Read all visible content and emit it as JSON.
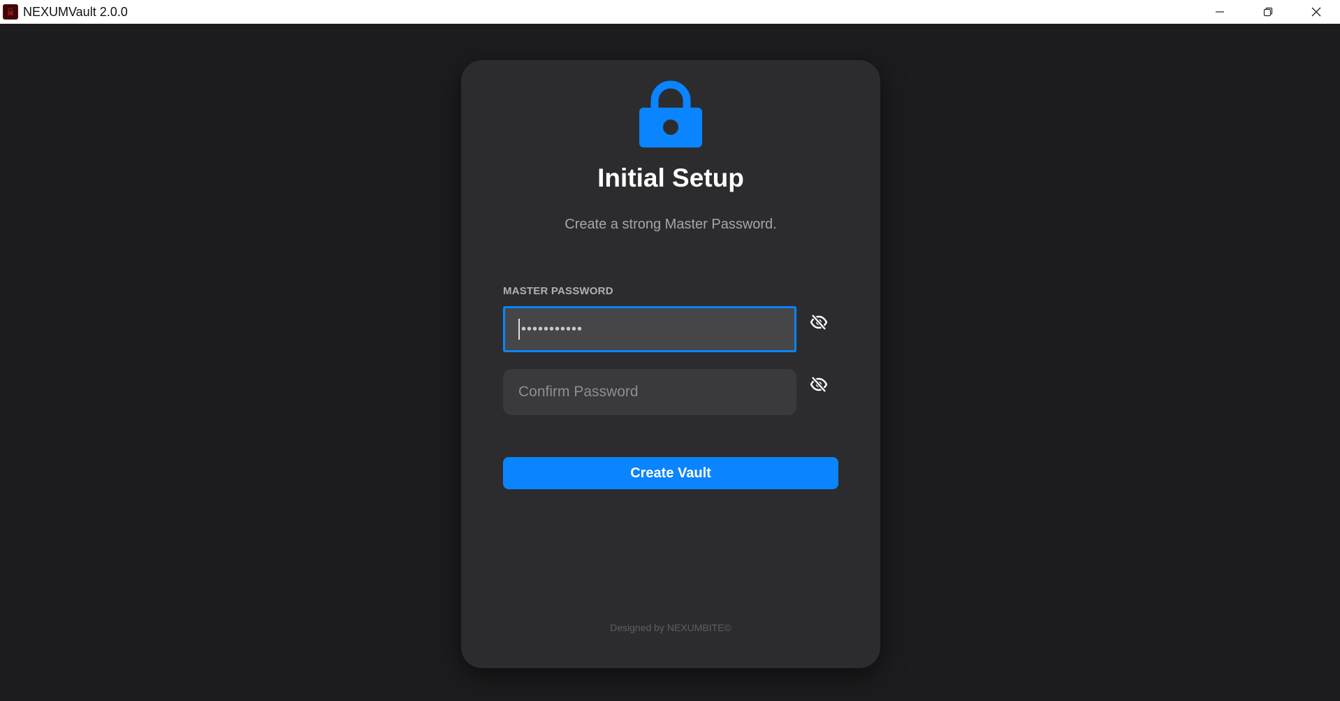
{
  "window": {
    "title": "NEXUMVault 2.0.0",
    "controls": [
      "minimize",
      "restore",
      "close"
    ]
  },
  "setup": {
    "title": "Initial Setup",
    "subtitle": "Create a strong Master Password.",
    "master_label": "MASTER PASSWORD",
    "master_value_masked": "•••••••••••",
    "confirm_placeholder": "Confirm Password",
    "create_button": "Create Vault",
    "footer": "Designed by NEXUMBITE©"
  },
  "icons": {
    "lock": "lock-icon",
    "toggle_visibility": "eye-slash-icon"
  },
  "colors": {
    "accent": "#0a84ff",
    "background": "#1c1c1e",
    "card": "#2c2c2e",
    "input": "#3a3a3c"
  }
}
